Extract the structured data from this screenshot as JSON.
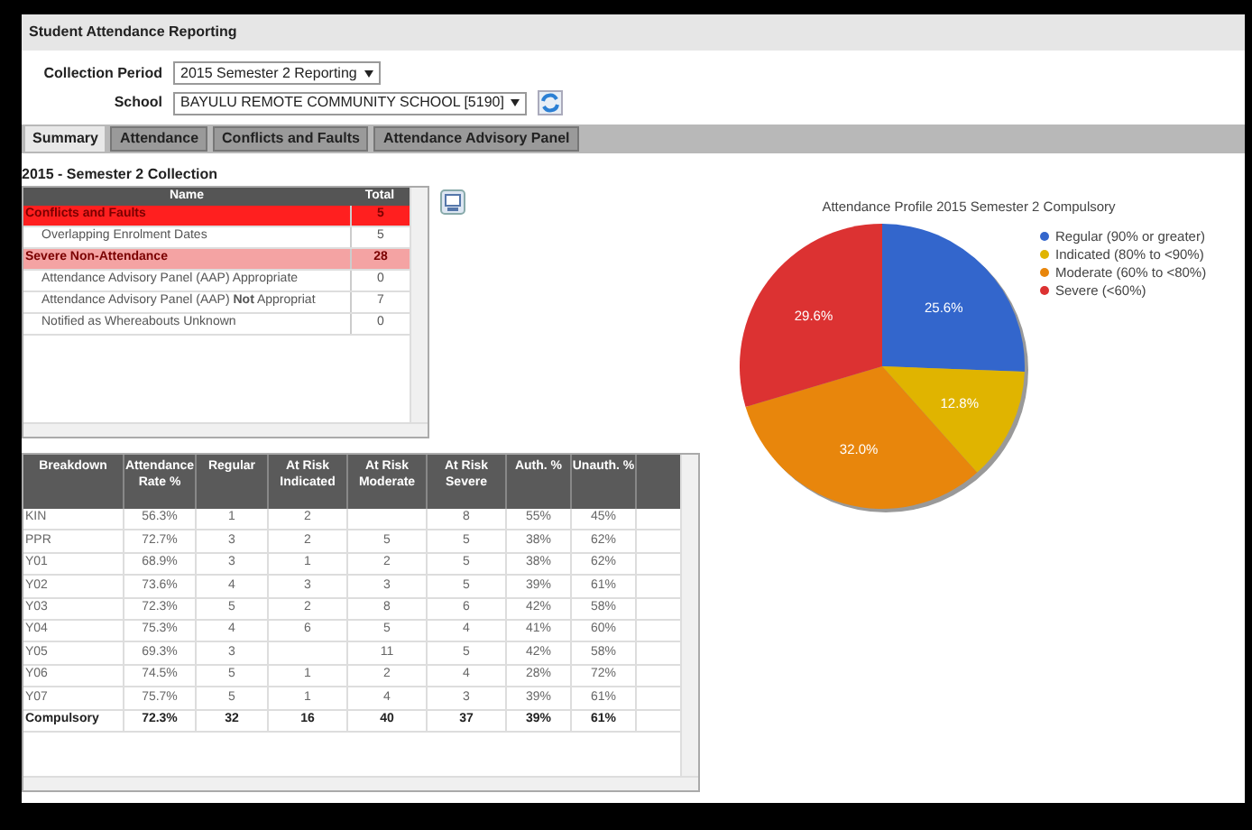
{
  "window": {
    "title": "Student Attendance Reporting"
  },
  "filters": [
    {
      "label": "Collection Period",
      "value": "2015 Semester 2 Reporting"
    },
    {
      "label": "School",
      "value": "BAYULU REMOTE COMMUNITY SCHOOL [5190]"
    }
  ],
  "tabs": [
    {
      "label": "Summary",
      "selected": true
    },
    {
      "label": "Attendance",
      "selected": false
    },
    {
      "label": "Conflicts and Faults",
      "selected": false
    },
    {
      "label": "Attendance Advisory Panel",
      "selected": false
    }
  ],
  "section_title": "2015 - Semester 2 Collection",
  "summary_table": {
    "columns": [
      "Name",
      "Total"
    ],
    "rows": [
      {
        "kind": "group",
        "color": "#ff1f1f",
        "name": "Conflicts and Faults",
        "total": "5"
      },
      {
        "kind": "item",
        "name": "Overlapping Enrolment Dates",
        "total": "5"
      },
      {
        "kind": "group",
        "color": "#f4a3a3",
        "name": "Severe Non-Attendance",
        "total": "28"
      },
      {
        "kind": "item",
        "name": "Attendance Advisory Panel (AAP) Appropriate",
        "total": "0"
      },
      {
        "kind": "item",
        "name": "Attendance Advisory Panel (AAP) **Not** Appropriat",
        "total": "7"
      },
      {
        "kind": "item",
        "name": "Notified as Whereabouts Unknown",
        "total": "0"
      }
    ]
  },
  "breakdown_table": {
    "columns": [
      "Breakdown",
      "Attendance Rate %",
      "Regular",
      "At Risk Indicated",
      "At Risk Moderate",
      "At Risk Severe",
      "Auth. %",
      "Unauth. %"
    ],
    "rows": [
      {
        "kind": "row",
        "cells": [
          "KIN",
          "56.3%",
          "1",
          "2",
          "",
          "8",
          "55%",
          "45%"
        ]
      },
      {
        "kind": "row",
        "cells": [
          "PPR",
          "72.7%",
          "3",
          "2",
          "5",
          "5",
          "38%",
          "62%"
        ]
      },
      {
        "kind": "row",
        "cells": [
          "Y01",
          "68.9%",
          "3",
          "1",
          "2",
          "5",
          "38%",
          "62%"
        ]
      },
      {
        "kind": "row",
        "cells": [
          "Y02",
          "73.6%",
          "4",
          "3",
          "3",
          "5",
          "39%",
          "61%"
        ]
      },
      {
        "kind": "row",
        "cells": [
          "Y03",
          "72.3%",
          "5",
          "2",
          "8",
          "6",
          "42%",
          "58%"
        ]
      },
      {
        "kind": "row",
        "cells": [
          "Y04",
          "75.3%",
          "4",
          "6",
          "5",
          "4",
          "41%",
          "60%"
        ]
      },
      {
        "kind": "row",
        "cells": [
          "Y05",
          "69.3%",
          "3",
          "",
          "11",
          "5",
          "42%",
          "58%"
        ]
      },
      {
        "kind": "row",
        "cells": [
          "Y06",
          "74.5%",
          "5",
          "1",
          "2",
          "4",
          "28%",
          "72%"
        ]
      },
      {
        "kind": "row",
        "cells": [
          "Y07",
          "75.7%",
          "5",
          "1",
          "4",
          "3",
          "39%",
          "61%"
        ]
      },
      {
        "kind": "total",
        "cells": [
          "Compulsory",
          "72.3%",
          "32",
          "16",
          "40",
          "37",
          "39%",
          "61%"
        ]
      }
    ]
  },
  "chart": {
    "chart_data": {
      "type": "pie",
      "title": "Attendance Profile 2015 Semester 2 Compulsory",
      "categories": [
        "Regular (90% or greater)",
        "Indicated (80% to <90%)",
        "Moderate (60% to <80%)",
        "Severe (<60%)"
      ],
      "series": [
        {
          "values": [
            25.6,
            12.8,
            32.0,
            29.6
          ]
        }
      ],
      "legend": "right",
      "colors": [
        "#3366cc",
        "#e0b400",
        "#e8860c",
        "#dc3232"
      ],
      "value_labels": [
        "25.6%",
        "12.8%",
        "32.0%",
        "29.6%"
      ]
    }
  }
}
